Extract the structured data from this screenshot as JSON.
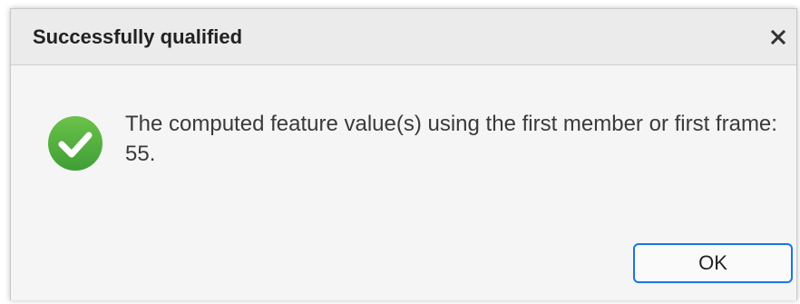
{
  "dialog": {
    "title": "Successfully qualified",
    "message": "The computed feature value(s) using the first member or first frame: 55.",
    "ok_label": "OK"
  },
  "icons": {
    "close": "close-icon",
    "status": "check-circle-icon"
  },
  "colors": {
    "success_green": "#52b443",
    "button_border": "#1a73e8"
  }
}
